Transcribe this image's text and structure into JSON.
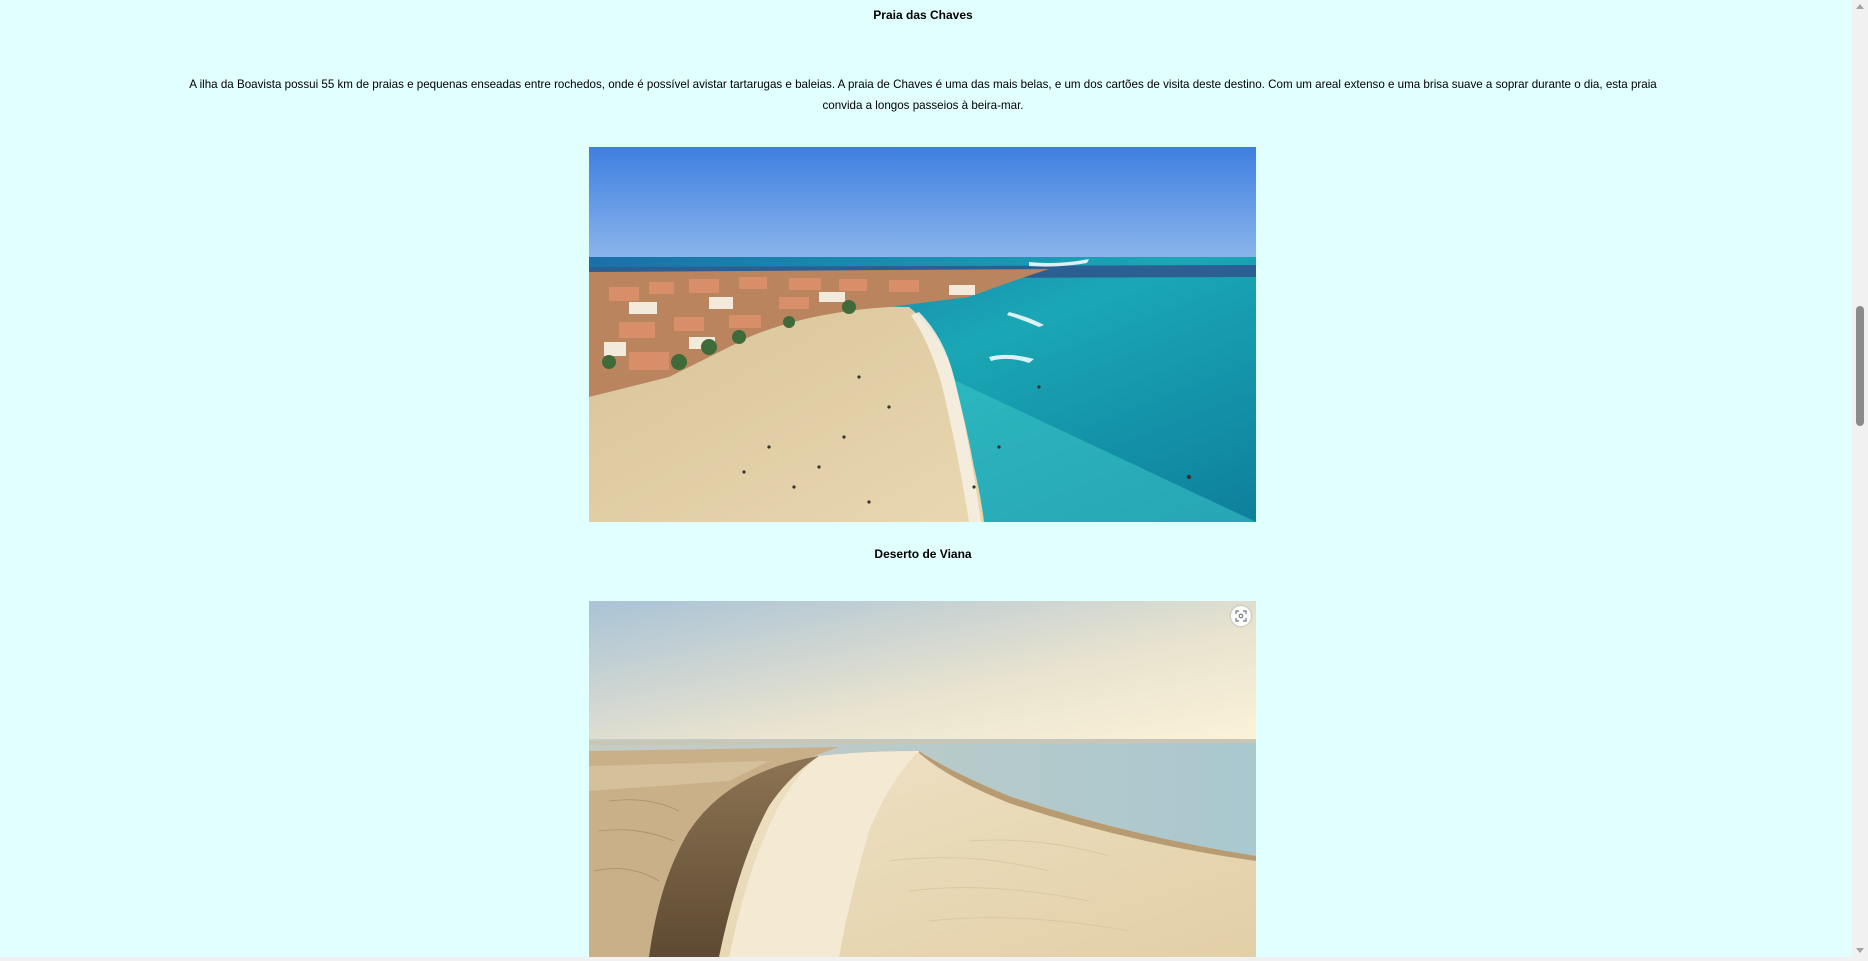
{
  "sections": [
    {
      "title": "Praia das Chaves",
      "text": "A ilha da Boavista possui 55 km de praias e pequenas enseadas entre rochedos, onde é possível avistar tartarugas e baleias. A praia de Chaves é uma das mais belas, e um dos cartões de visita deste destino. Com um areal extenso e uma brisa suave a soprar durante o dia, esta praia convida a longos passeios à beira-mar."
    },
    {
      "title": "Deserto de Viana"
    }
  ],
  "icons": {
    "image_search": "lens-icon"
  },
  "colors": {
    "page_background": "#e0fffe"
  }
}
